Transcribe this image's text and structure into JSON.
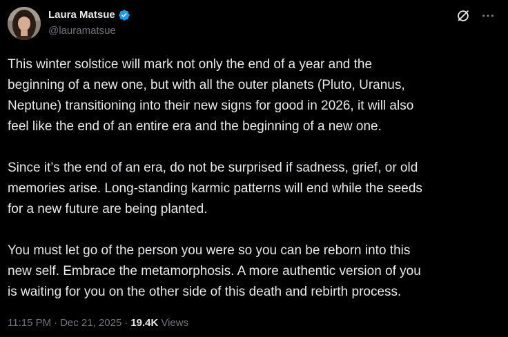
{
  "author": {
    "display_name": "Laura Matsue",
    "handle": "@lauramatsue",
    "verified": true,
    "verified_color": "#1d9bf0"
  },
  "header_icons": {
    "grok": "grok-icon",
    "more": "more-icon"
  },
  "tweet": {
    "paragraphs": [
      "This winter solstice will mark not only the end of a year and the\nbeginning of a new one, but with all the outer planets (Pluto, Uranus,\nNeptune) transitioning into their new signs for good in 2026, it will also\nfeel like the end of an entire era and the beginning of a new one.",
      "Since it’s the end of an era, do not be surprised if sadness, grief, or old\nmemories arise. Long-standing karmic patterns will end while the seeds\nfor a new future are being planted.",
      "You must let go of the person you were so you can be reborn into this\nnew self. Embrace the metamorphosis. A more authentic version of you\nis waiting for you on the other side of this death and rebirth process."
    ]
  },
  "meta": {
    "time": "11:15 PM",
    "separator": "·",
    "date": "Dec 21, 2025",
    "views_count": "19.4K",
    "views_label": "Views"
  },
  "colors": {
    "background": "#000000",
    "text_primary": "#e7e9ea",
    "text_secondary": "#71767b"
  }
}
